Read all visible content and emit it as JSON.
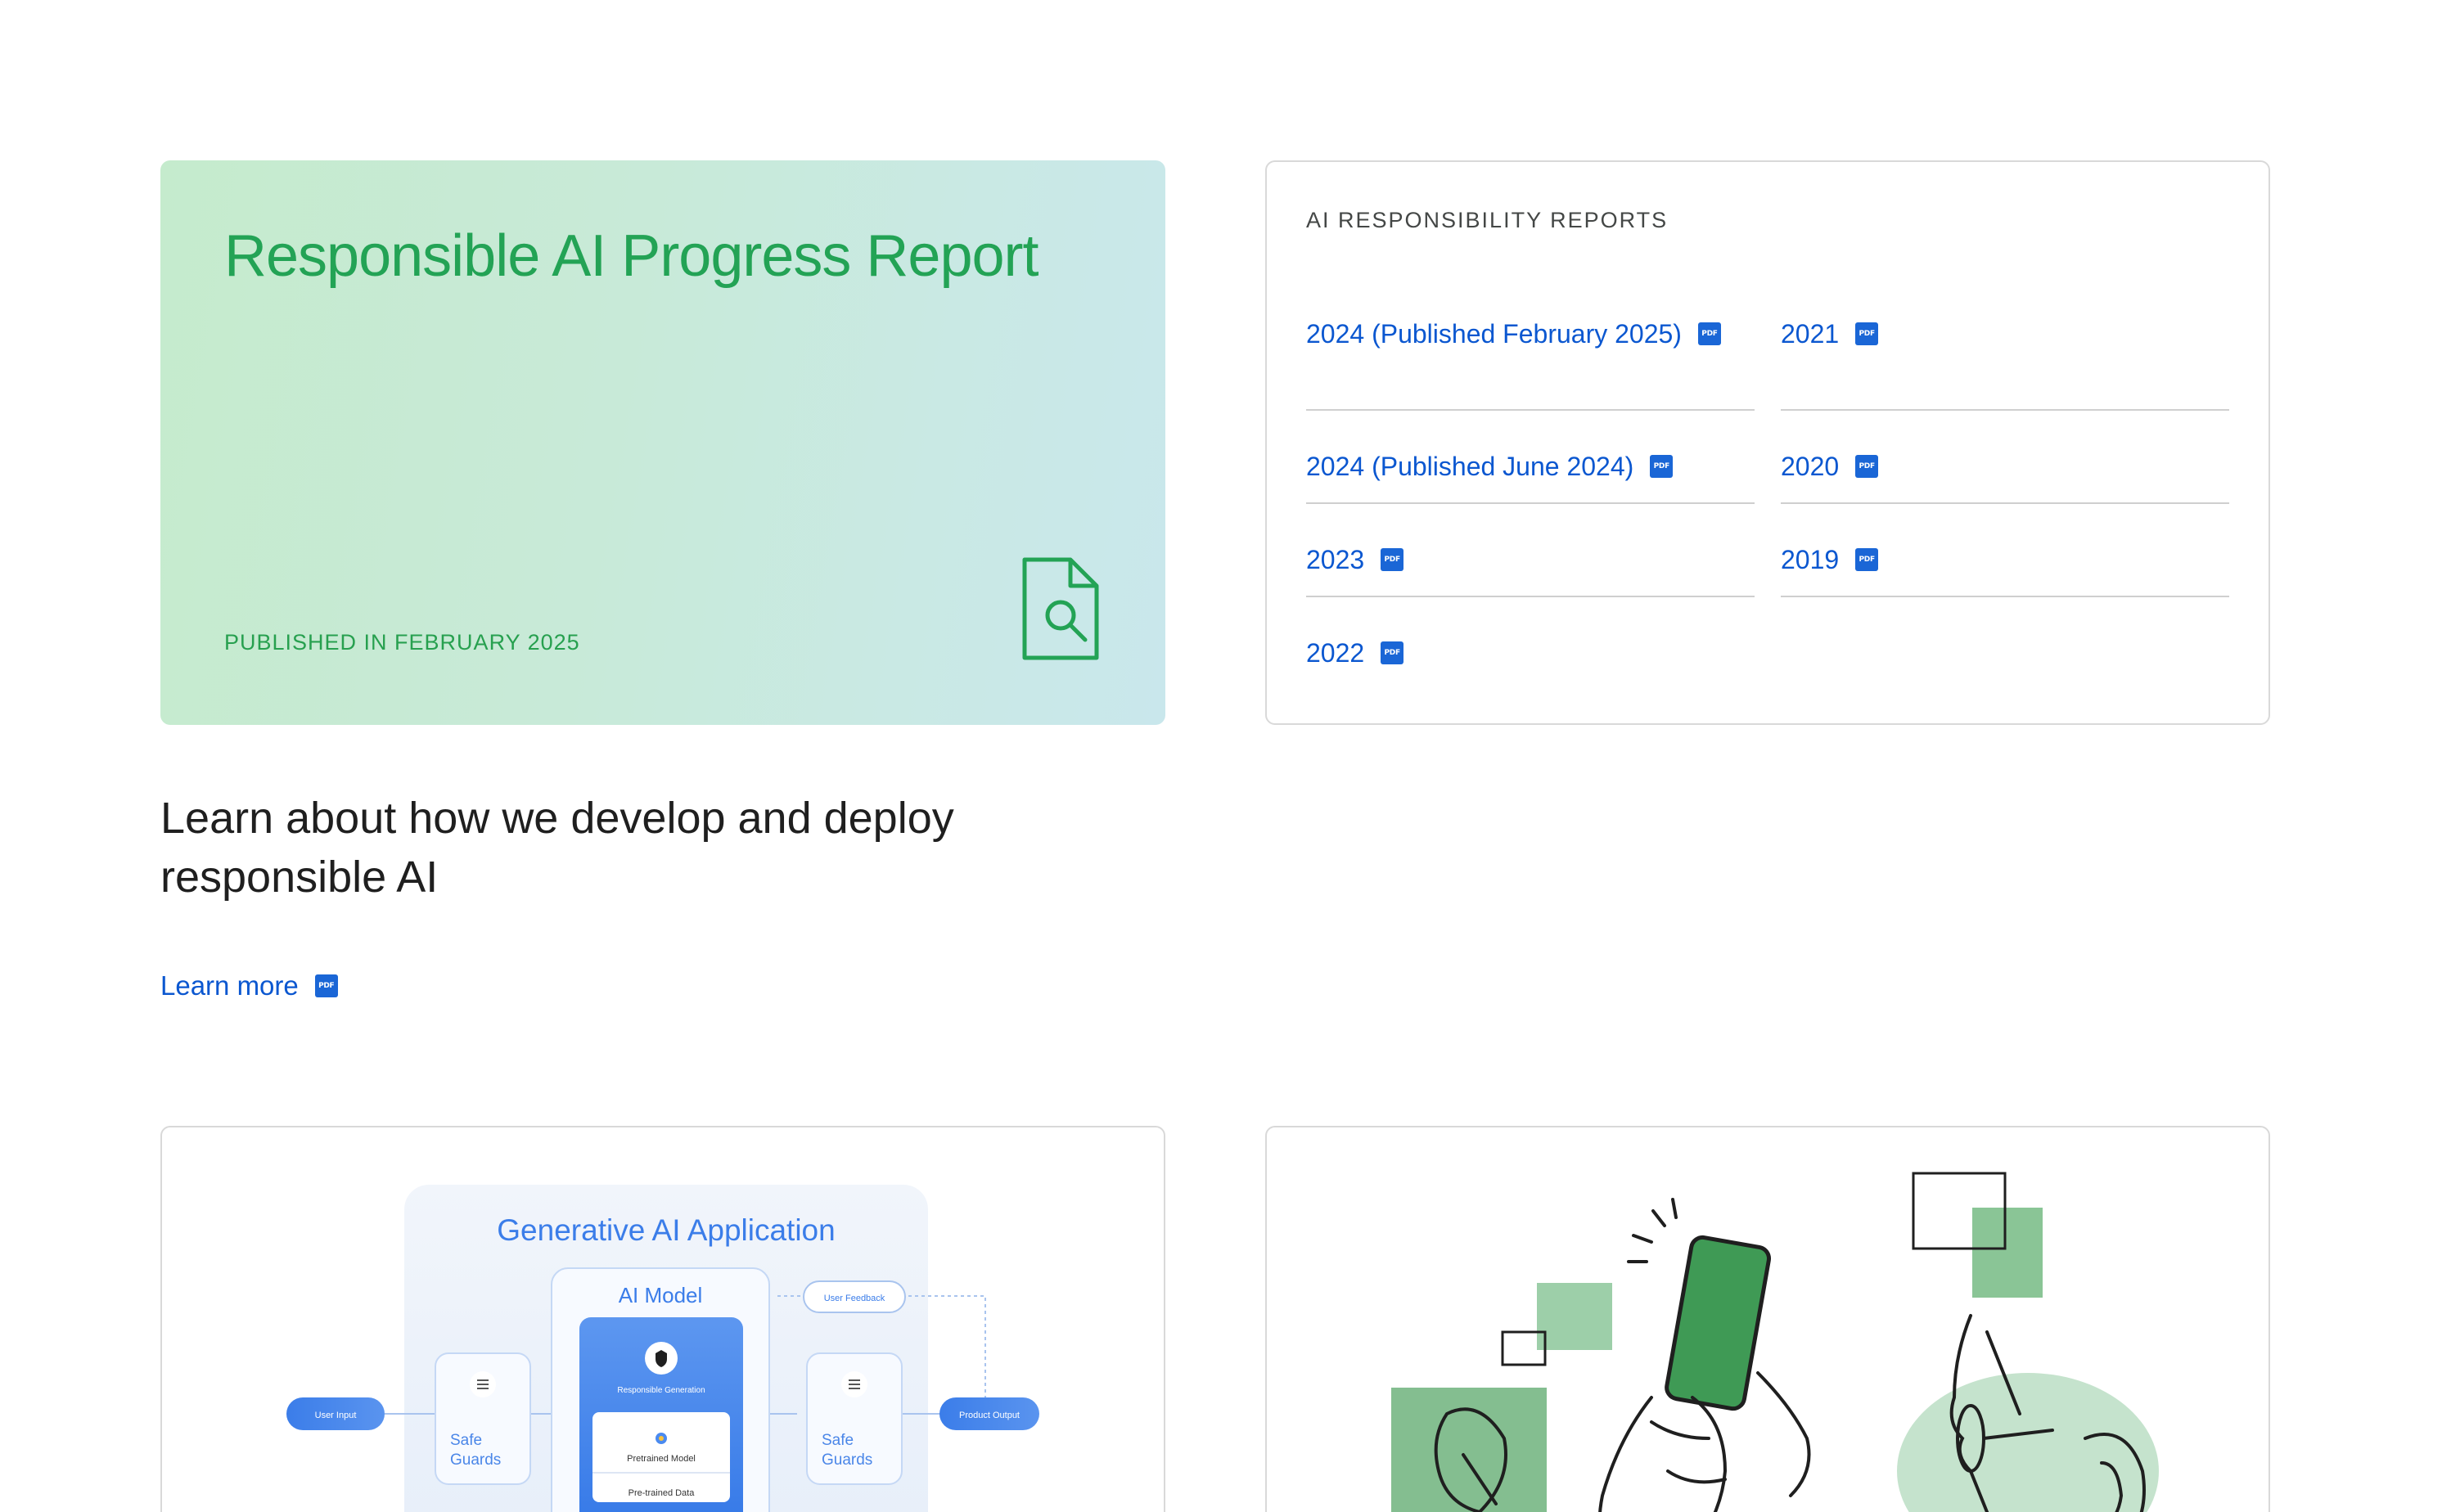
{
  "hero": {
    "title": "Responsible AI Progress Report",
    "published": "PUBLISHED IN FEBRUARY 2025",
    "icon": "document-search-icon",
    "colors": {
      "title": "#23a355",
      "gradient_start": "#c5ebcd",
      "gradient_end": "#c9e7ec"
    }
  },
  "reports": {
    "eyebrow": "AI RESPONSIBILITY REPORTS",
    "pdf_badge": "PDF",
    "left_items": [
      {
        "label": "2024 (Published February 2025)"
      },
      {
        "label": "2024 (Published June 2024)"
      },
      {
        "label": "2023"
      },
      {
        "label": "2022"
      }
    ],
    "right_items": [
      {
        "label": "2021"
      },
      {
        "label": "2020"
      },
      {
        "label": "2019"
      }
    ],
    "link_color": "#0b57d0"
  },
  "learn": {
    "heading": "Learn about how we develop and deploy responsible AI",
    "link": "Learn more"
  },
  "diagram": {
    "title": "Generative AI Application",
    "model_label": "AI Model",
    "user_feedback": "User Feedback",
    "user_input": "User Input",
    "product_output": "Product Output",
    "safe_guards_line1": "Safe",
    "safe_guards_line2": "Guards",
    "responsible_generation": "Responsible Generation",
    "pretrained_model": "Pretrained Model",
    "pretrained_data": "Pre-trained Data"
  },
  "illustration": {
    "icon": "person-phone-illustration"
  }
}
